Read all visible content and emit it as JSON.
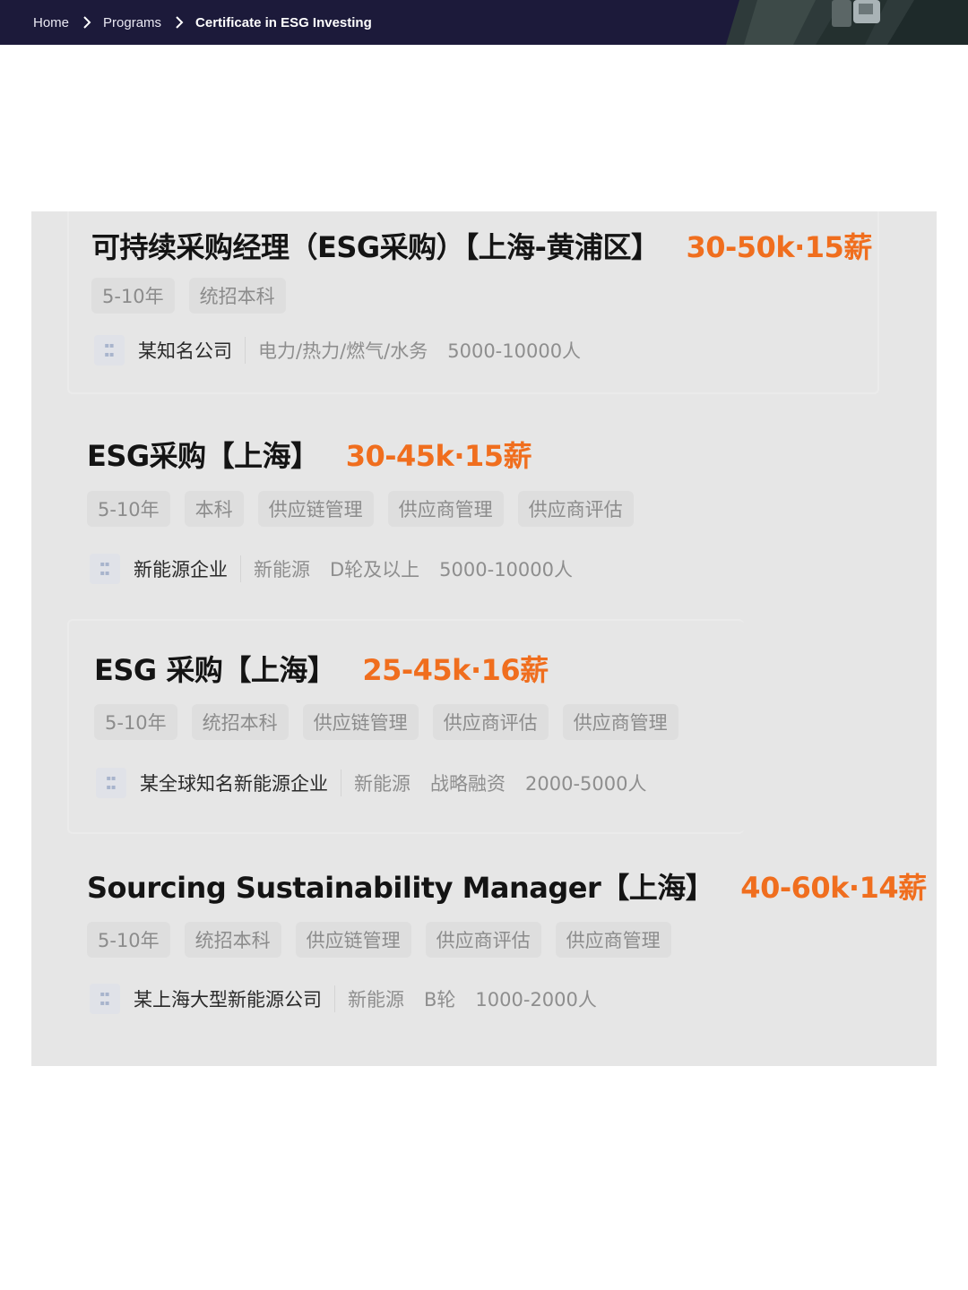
{
  "breadcrumb": {
    "items": [
      "Home",
      "Programs",
      "Certificate in ESG Investing"
    ]
  },
  "jobs": [
    {
      "title": "可持续采购经理（ESG采购）【上海-黄浦区】",
      "salary": "30-50k·15薪",
      "tags": [
        "5-10年",
        "统招本科"
      ],
      "company": "某知名公司",
      "meta": [
        "电力/热力/燃气/水务",
        "5000-10000人"
      ]
    },
    {
      "title": "ESG采购【上海】",
      "salary": "30-45k·15薪",
      "tags": [
        "5-10年",
        "本科",
        "供应链管理",
        "供应商管理",
        "供应商评估"
      ],
      "company": "新能源企业",
      "meta": [
        "新能源",
        "D轮及以上",
        "5000-10000人"
      ]
    },
    {
      "title": "ESG 采购【上海】",
      "salary": "25-45k·16薪",
      "tags": [
        "5-10年",
        "统招本科",
        "供应链管理",
        "供应商评估",
        "供应商管理"
      ],
      "company": "某全球知名新能源企业",
      "meta": [
        "新能源",
        "战略融资",
        "2000-5000人"
      ]
    },
    {
      "title": "Sourcing Sustainability Manager【上海】",
      "salary": "40-60k·14薪",
      "tags": [
        "5-10年",
        "统招本科",
        "供应链管理",
        "供应商评估",
        "供应商管理"
      ],
      "company": "某上海大型新能源公司",
      "meta": [
        "新能源",
        "B轮",
        "1000-2000人"
      ]
    }
  ],
  "colors": {
    "topbar": "#1c1a3a",
    "salary": "#f06e1e",
    "panel": "#e6e6e6"
  },
  "icons": {
    "separator": "chevron-right-icon",
    "company_logo": "company-logo-placeholder"
  }
}
